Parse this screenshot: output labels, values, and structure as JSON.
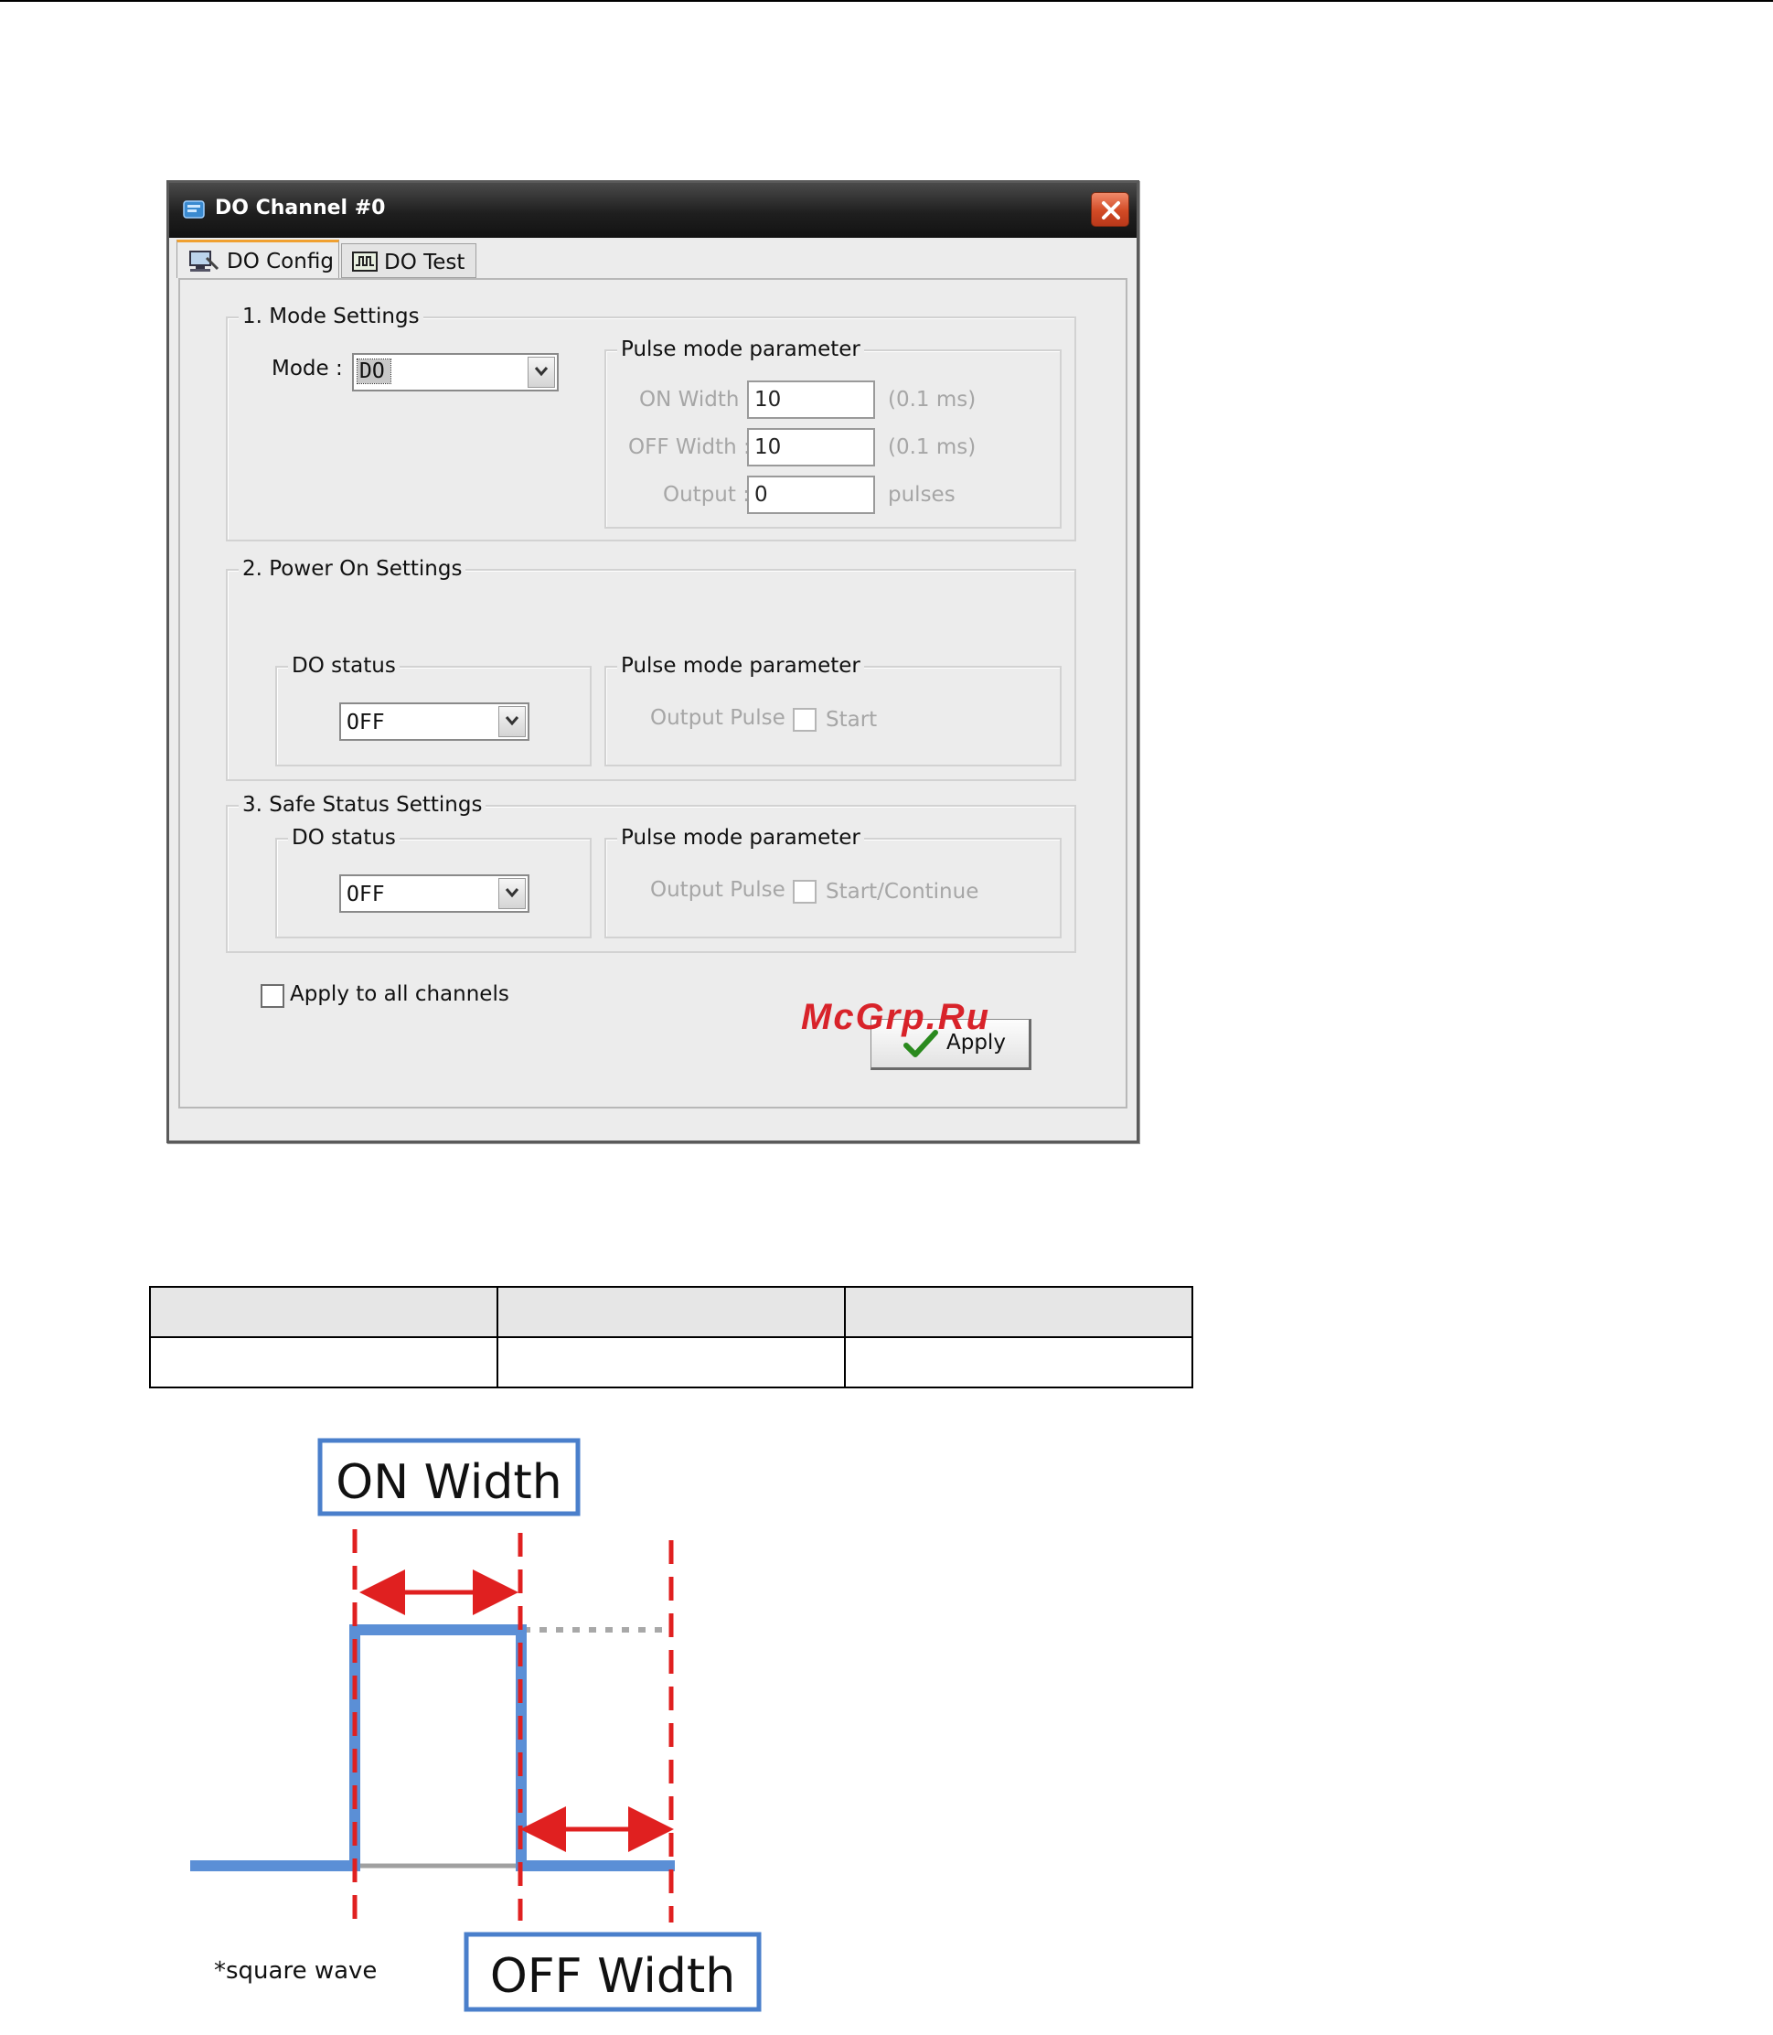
{
  "window": {
    "title": "DO Channel #0",
    "tabs": [
      {
        "label": "DO Config",
        "active": true
      },
      {
        "label": "DO Test",
        "active": false
      }
    ]
  },
  "mode_settings": {
    "legend": "1. Mode Settings",
    "mode_label": "Mode :",
    "mode_value": "DO",
    "pulse": {
      "legend": "Pulse mode parameter",
      "on_width_label": "ON Width :",
      "on_width_value": "10",
      "on_width_unit": "(0.1 ms)",
      "off_width_label": "OFF Width :",
      "off_width_value": "10",
      "off_width_unit": "(0.1 ms)",
      "output_label": "Output :",
      "output_value": "0",
      "output_unit": "pulses"
    }
  },
  "power_on": {
    "legend": "2. Power On Settings",
    "do_status_legend": "DO status",
    "do_status_value": "OFF",
    "pulse_legend": "Pulse mode parameter",
    "output_pulse_label": "Output Pulse :",
    "start_label": "Start"
  },
  "safe_status": {
    "legend": "3. Safe Status Settings",
    "do_status_legend": "DO status",
    "do_status_value": "OFF",
    "pulse_legend": "Pulse mode parameter",
    "output_pulse_label": "Output Pulse :",
    "start_label": "Start/Continue"
  },
  "apply_all_label": "Apply to all channels",
  "apply_button_label": "Apply",
  "watermark": "McGrp.Ru",
  "diagram": {
    "on_width_label": "ON Width",
    "off_width_label": "OFF Width",
    "note": "*square wave",
    "colors": {
      "wave": "#5b8fd6",
      "marker": "#e02020",
      "box_border": "#4a7fcb"
    }
  },
  "colors": {
    "title_bar": "#1f1f1f",
    "close": "#d24a25",
    "disabled_text": "#a6a6a6"
  }
}
